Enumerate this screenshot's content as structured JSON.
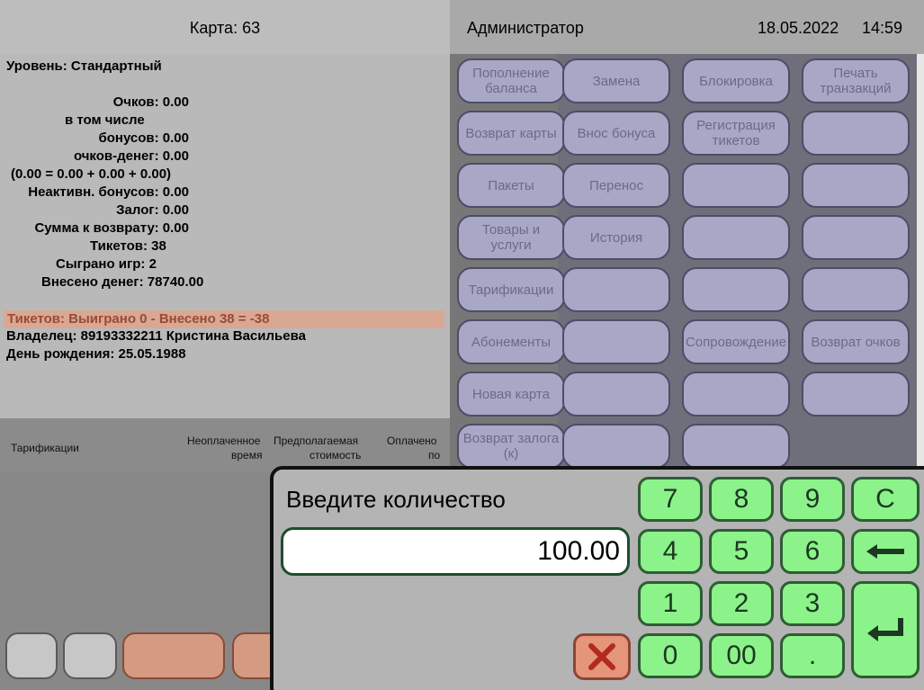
{
  "header": {
    "card": "Карта: 63",
    "user": "Администратор",
    "date": "18.05.2022",
    "time": "14:59"
  },
  "card_info": {
    "level": "Уровень: Стандартный",
    "points": "Очков: 0.00",
    "including": "в том числе",
    "bonuses": "бонусов: 0.00",
    "money_points": "очков-денег: 0.00",
    "formula": "(0.00 = 0.00 + 0.00 + 0.00)",
    "inactive_bonuses": "Неактивн. бонусов: 0.00",
    "deposit": "Залог: 0.00",
    "refund": "Сумма к возврату: 0.00",
    "tickets": "Тикетов: 38",
    "games": "Сыграно игр: 2",
    "money_in": "Внесено денег: 78740.00",
    "tickets_balance": "Тикетов: Выиграно 0 - Внесено 38 = -38",
    "owner": "Владелец: 89193332211 Кристина  Васильева",
    "birthday": "День рождения: 25.05.1988"
  },
  "table": {
    "col1": "Тарификации",
    "col2a": "Неоплаченное",
    "col2b": "время",
    "col3a": "Предполагаемая",
    "col3b": "стоимость",
    "col4a": "Оплачено",
    "col4b": "по"
  },
  "buttons": {
    "topup": "Пополнение баланса",
    "replace": "Замена",
    "block": "Блокировка",
    "print_tx": "Печать транзакций",
    "return_card": "Возврат карты",
    "bonus_in": "Внос бонуса",
    "ticket_reg": "Регистрация тикетов",
    "packages": "Пакеты",
    "transfer": "Перенос",
    "goods": "Товары и услуги",
    "history": "История",
    "tariffs": "Тарификации",
    "subscriptions": "Абонементы",
    "escort": "Сопровождение",
    "return_points": "Возврат очков",
    "new_card": "Новая карта",
    "return_deposit": "Возврат залога (к)"
  },
  "dialog": {
    "prompt": "Введите количество",
    "value": "100.00",
    "keys": {
      "k7": "7",
      "k8": "8",
      "k9": "9",
      "kc": "C",
      "k4": "4",
      "k5": "5",
      "k6": "6",
      "k1": "1",
      "k2": "2",
      "k3": "3",
      "k0": "0",
      "k00": "00",
      "kdot": "."
    }
  },
  "colors": {
    "numpad_key": "#8cf28a",
    "grid_button": "#a9a7c6",
    "cancel_button": "#e5967a"
  }
}
